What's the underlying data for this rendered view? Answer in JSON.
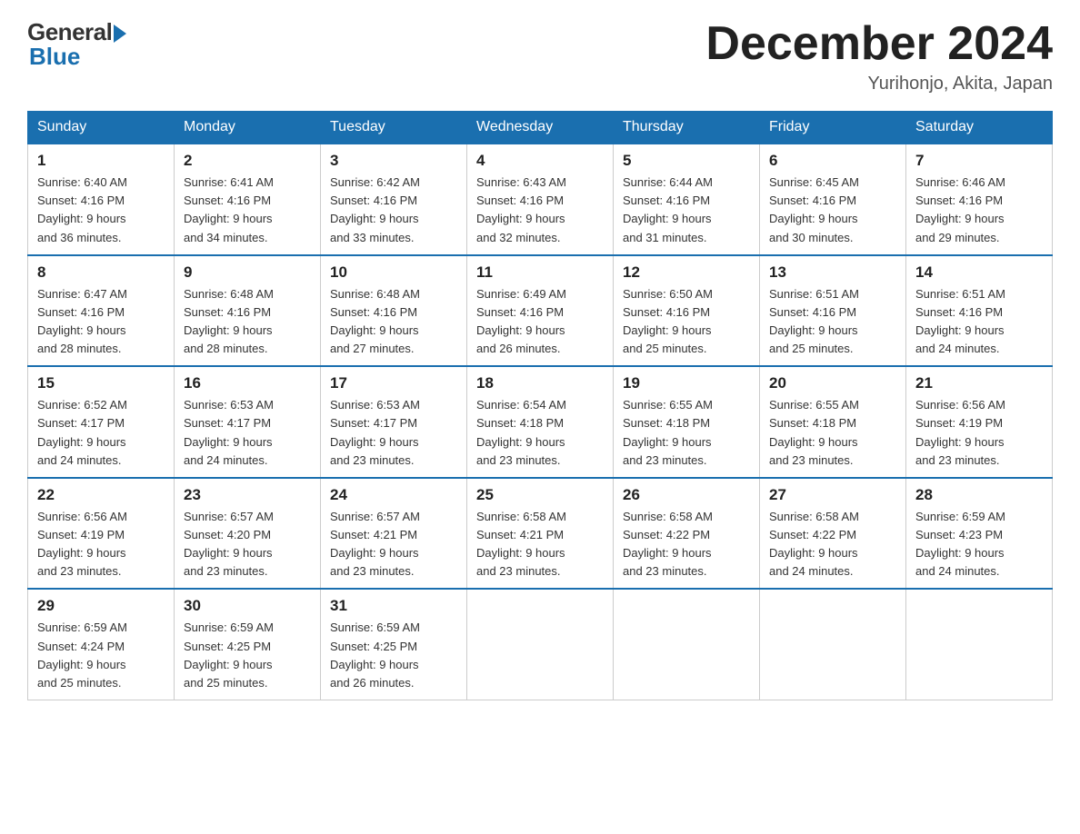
{
  "logo": {
    "general": "General",
    "blue": "Blue"
  },
  "header": {
    "title": "December 2024",
    "subtitle": "Yurihonjo, Akita, Japan"
  },
  "weekdays": [
    "Sunday",
    "Monday",
    "Tuesday",
    "Wednesday",
    "Thursday",
    "Friday",
    "Saturday"
  ],
  "weeks": [
    [
      {
        "day": "1",
        "sunrise": "6:40 AM",
        "sunset": "4:16 PM",
        "daylight": "9 hours and 36 minutes."
      },
      {
        "day": "2",
        "sunrise": "6:41 AM",
        "sunset": "4:16 PM",
        "daylight": "9 hours and 34 minutes."
      },
      {
        "day": "3",
        "sunrise": "6:42 AM",
        "sunset": "4:16 PM",
        "daylight": "9 hours and 33 minutes."
      },
      {
        "day": "4",
        "sunrise": "6:43 AM",
        "sunset": "4:16 PM",
        "daylight": "9 hours and 32 minutes."
      },
      {
        "day": "5",
        "sunrise": "6:44 AM",
        "sunset": "4:16 PM",
        "daylight": "9 hours and 31 minutes."
      },
      {
        "day": "6",
        "sunrise": "6:45 AM",
        "sunset": "4:16 PM",
        "daylight": "9 hours and 30 minutes."
      },
      {
        "day": "7",
        "sunrise": "6:46 AM",
        "sunset": "4:16 PM",
        "daylight": "9 hours and 29 minutes."
      }
    ],
    [
      {
        "day": "8",
        "sunrise": "6:47 AM",
        "sunset": "4:16 PM",
        "daylight": "9 hours and 28 minutes."
      },
      {
        "day": "9",
        "sunrise": "6:48 AM",
        "sunset": "4:16 PM",
        "daylight": "9 hours and 28 minutes."
      },
      {
        "day": "10",
        "sunrise": "6:48 AM",
        "sunset": "4:16 PM",
        "daylight": "9 hours and 27 minutes."
      },
      {
        "day": "11",
        "sunrise": "6:49 AM",
        "sunset": "4:16 PM",
        "daylight": "9 hours and 26 minutes."
      },
      {
        "day": "12",
        "sunrise": "6:50 AM",
        "sunset": "4:16 PM",
        "daylight": "9 hours and 25 minutes."
      },
      {
        "day": "13",
        "sunrise": "6:51 AM",
        "sunset": "4:16 PM",
        "daylight": "9 hours and 25 minutes."
      },
      {
        "day": "14",
        "sunrise": "6:51 AM",
        "sunset": "4:16 PM",
        "daylight": "9 hours and 24 minutes."
      }
    ],
    [
      {
        "day": "15",
        "sunrise": "6:52 AM",
        "sunset": "4:17 PM",
        "daylight": "9 hours and 24 minutes."
      },
      {
        "day": "16",
        "sunrise": "6:53 AM",
        "sunset": "4:17 PM",
        "daylight": "9 hours and 24 minutes."
      },
      {
        "day": "17",
        "sunrise": "6:53 AM",
        "sunset": "4:17 PM",
        "daylight": "9 hours and 23 minutes."
      },
      {
        "day": "18",
        "sunrise": "6:54 AM",
        "sunset": "4:18 PM",
        "daylight": "9 hours and 23 minutes."
      },
      {
        "day": "19",
        "sunrise": "6:55 AM",
        "sunset": "4:18 PM",
        "daylight": "9 hours and 23 minutes."
      },
      {
        "day": "20",
        "sunrise": "6:55 AM",
        "sunset": "4:18 PM",
        "daylight": "9 hours and 23 minutes."
      },
      {
        "day": "21",
        "sunrise": "6:56 AM",
        "sunset": "4:19 PM",
        "daylight": "9 hours and 23 minutes."
      }
    ],
    [
      {
        "day": "22",
        "sunrise": "6:56 AM",
        "sunset": "4:19 PM",
        "daylight": "9 hours and 23 minutes."
      },
      {
        "day": "23",
        "sunrise": "6:57 AM",
        "sunset": "4:20 PM",
        "daylight": "9 hours and 23 minutes."
      },
      {
        "day": "24",
        "sunrise": "6:57 AM",
        "sunset": "4:21 PM",
        "daylight": "9 hours and 23 minutes."
      },
      {
        "day": "25",
        "sunrise": "6:58 AM",
        "sunset": "4:21 PM",
        "daylight": "9 hours and 23 minutes."
      },
      {
        "day": "26",
        "sunrise": "6:58 AM",
        "sunset": "4:22 PM",
        "daylight": "9 hours and 23 minutes."
      },
      {
        "day": "27",
        "sunrise": "6:58 AM",
        "sunset": "4:22 PM",
        "daylight": "9 hours and 24 minutes."
      },
      {
        "day": "28",
        "sunrise": "6:59 AM",
        "sunset": "4:23 PM",
        "daylight": "9 hours and 24 minutes."
      }
    ],
    [
      {
        "day": "29",
        "sunrise": "6:59 AM",
        "sunset": "4:24 PM",
        "daylight": "9 hours and 25 minutes."
      },
      {
        "day": "30",
        "sunrise": "6:59 AM",
        "sunset": "4:25 PM",
        "daylight": "9 hours and 25 minutes."
      },
      {
        "day": "31",
        "sunrise": "6:59 AM",
        "sunset": "4:25 PM",
        "daylight": "9 hours and 26 minutes."
      },
      null,
      null,
      null,
      null
    ]
  ]
}
